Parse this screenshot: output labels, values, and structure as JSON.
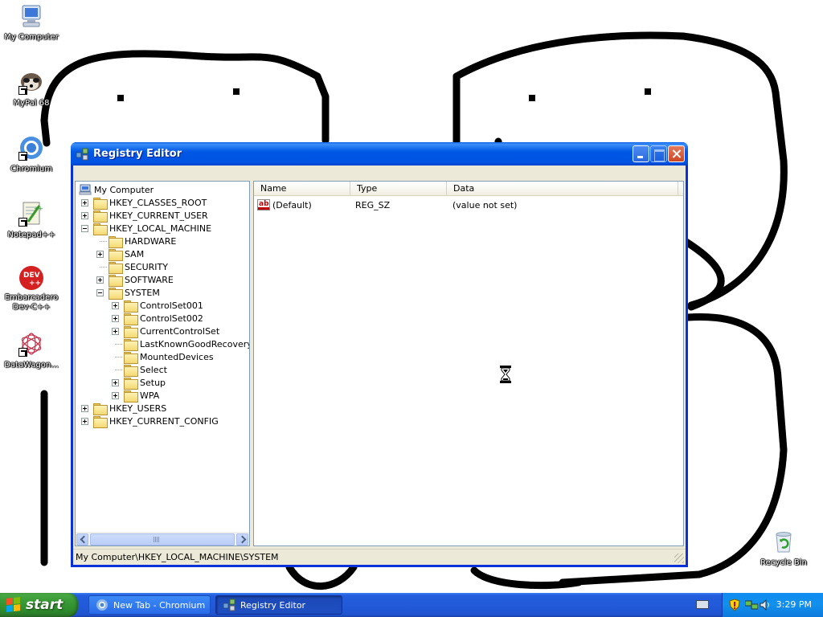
{
  "desktop": {
    "icons": [
      {
        "label": "My Computer",
        "icon": "my-computer-icon"
      },
      {
        "label": "MyPal 68",
        "icon": "mypal-icon"
      },
      {
        "label": "Chromium",
        "icon": "chromium-icon"
      },
      {
        "label": "Notepad++",
        "icon": "notepadpp-icon"
      },
      {
        "label": "Embarcadero Dev-C++",
        "icon": "devcpp-icon"
      },
      {
        "label": "DataWagon...",
        "icon": "datawagon-icon"
      },
      {
        "label": "Recycle Bin",
        "icon": "recycle-bin-icon"
      }
    ]
  },
  "window": {
    "title": "Registry Editor",
    "tree": {
      "root": "My Computer",
      "nodes": [
        {
          "label": "HKEY_CLASSES_ROOT",
          "depth": 1,
          "expander": "plus"
        },
        {
          "label": "HKEY_CURRENT_USER",
          "depth": 1,
          "expander": "plus"
        },
        {
          "label": "HKEY_LOCAL_MACHINE",
          "depth": 1,
          "expander": "minus"
        },
        {
          "label": "HARDWARE",
          "depth": 2,
          "expander": "none"
        },
        {
          "label": "SAM",
          "depth": 2,
          "expander": "plus"
        },
        {
          "label": "SECURITY",
          "depth": 2,
          "expander": "none"
        },
        {
          "label": "SOFTWARE",
          "depth": 2,
          "expander": "plus"
        },
        {
          "label": "SYSTEM",
          "depth": 2,
          "expander": "minus"
        },
        {
          "label": "ControlSet001",
          "depth": 3,
          "expander": "plus"
        },
        {
          "label": "ControlSet002",
          "depth": 3,
          "expander": "plus"
        },
        {
          "label": "CurrentControlSet",
          "depth": 3,
          "expander": "plus"
        },
        {
          "label": "LastKnownGoodRecovery",
          "depth": 3,
          "expander": "none"
        },
        {
          "label": "MountedDevices",
          "depth": 3,
          "expander": "none"
        },
        {
          "label": "Select",
          "depth": 3,
          "expander": "none"
        },
        {
          "label": "Setup",
          "depth": 3,
          "expander": "plus"
        },
        {
          "label": "WPA",
          "depth": 3,
          "expander": "plus"
        },
        {
          "label": "HKEY_USERS",
          "depth": 1,
          "expander": "plus"
        },
        {
          "label": "HKEY_CURRENT_CONFIG",
          "depth": 1,
          "expander": "plus"
        }
      ]
    },
    "list": {
      "columns": [
        "Name",
        "Type",
        "Data"
      ],
      "rows": [
        {
          "name": "(Default)",
          "type": "REG_SZ",
          "data": "(value not set)"
        }
      ]
    },
    "status": "My Computer\\HKEY_LOCAL_MACHINE\\SYSTEM"
  },
  "taskbar": {
    "start_label": "start",
    "tasks": [
      {
        "label": "New Tab - Chromium",
        "active": false
      },
      {
        "label": "Registry Editor",
        "active": true
      }
    ],
    "clock": "3:29 PM"
  },
  "colors": {
    "title_bar": "#0058e5",
    "taskbar": "#245edc",
    "start_button": "#3c9c38",
    "tray": "#1290ed"
  }
}
